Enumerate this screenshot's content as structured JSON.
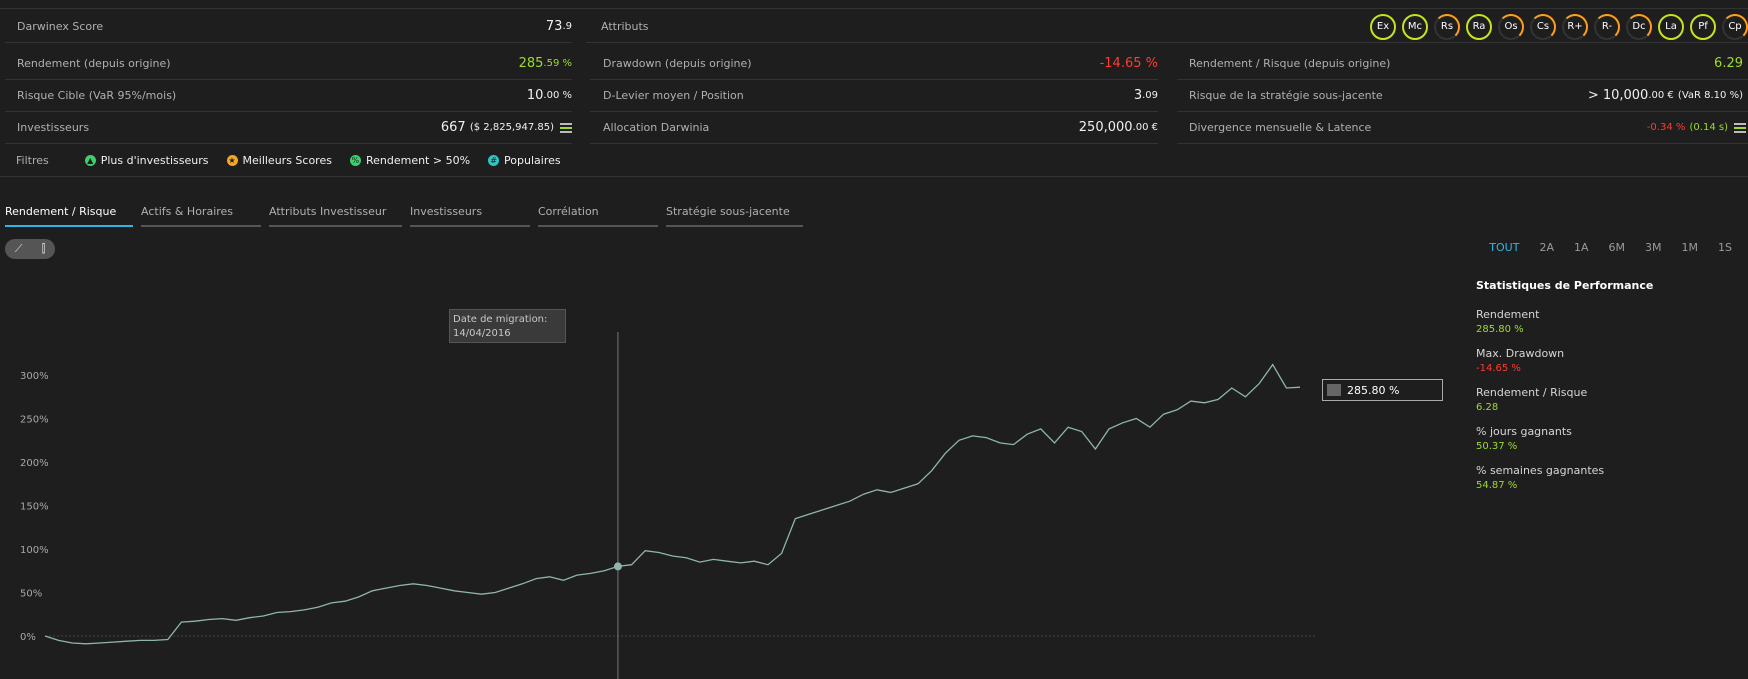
{
  "metrics": {
    "darwinex_score": {
      "label": "Darwinex Score",
      "value": "73",
      "decimals": ".9"
    },
    "attributs": {
      "label": "Attributs"
    },
    "rendement": {
      "label": "Rendement (depuis origine)",
      "value": "285",
      "decimals": ".59 %"
    },
    "drawdown": {
      "label": "Drawdown (depuis origine)",
      "value": "-14.65 %"
    },
    "rend_risque": {
      "label": "Rendement / Risque (depuis origine)",
      "value": "6.29"
    },
    "risque_cible": {
      "label": "Risque Cible (VaR 95%/mois)",
      "value": "10",
      "decimals": ".00 %"
    },
    "levier": {
      "label": "D-Levier moyen / Position",
      "value": "3",
      "decimals": ".09"
    },
    "risque_strat": {
      "label": "Risque de la stratégie sous-jacente",
      "value": "> 10,000",
      "decimals": ".00 €",
      "extra": "(VaR 8.10 %)"
    },
    "investisseurs": {
      "label": "Investisseurs",
      "value": "667",
      "extra": "($ 2,825,947.85)"
    },
    "allocation": {
      "label": "Allocation Darwinia",
      "value": "250,000",
      "decimals": ".00 €"
    },
    "divergence": {
      "label": "Divergence mensuelle & Latence",
      "value": "-0.34 %",
      "extra": "(0.14 s)"
    }
  },
  "attributes": [
    {
      "code": "Ex",
      "state": "full"
    },
    {
      "code": "Mc",
      "state": "full"
    },
    {
      "code": "Rs",
      "state": "part"
    },
    {
      "code": "Ra",
      "state": "full"
    },
    {
      "code": "Os",
      "state": "part"
    },
    {
      "code": "Cs",
      "state": "part"
    },
    {
      "code": "R+",
      "state": "part"
    },
    {
      "code": "R-",
      "state": "part"
    },
    {
      "code": "Dc",
      "state": "part"
    },
    {
      "code": "La",
      "state": "full"
    },
    {
      "code": "Pf",
      "state": "full"
    },
    {
      "code": "Cp",
      "state": "part"
    }
  ],
  "filters": {
    "label": "Filtres",
    "chips": [
      {
        "label": "Plus d'investisseurs",
        "color": "#3ecf6e"
      },
      {
        "label": "Meilleurs Scores",
        "color": "#f5a623"
      },
      {
        "label": "Rendement > 50%",
        "color": "#3ecf6e"
      },
      {
        "label": "Populaires",
        "color": "#2fc4c4"
      }
    ]
  },
  "tabs": [
    "Rendement / Risque",
    "Actifs & Horaires",
    "Attributs Investisseur",
    "Investisseurs",
    "Corrélation",
    "Stratégie sous-jacente"
  ],
  "range_buttons": [
    "TOUT",
    "2A",
    "1A",
    "6M",
    "3M",
    "1M",
    "1S"
  ],
  "range_active": "TOUT",
  "tooltip": {
    "title": "Date de migration:",
    "date": "14/04/2016"
  },
  "end_label": "285.80 %",
  "stats": {
    "title": "Statistiques de Performance",
    "items": [
      {
        "label": "Rendement",
        "value": "285.80 %",
        "tone": "green"
      },
      {
        "label": "Max. Drawdown",
        "value": "-14.65 %",
        "tone": "red"
      },
      {
        "label": "Rendement / Risque",
        "value": "6.28",
        "tone": "green"
      },
      {
        "label": "% jours gagnants",
        "value": "50.37 %",
        "tone": "green"
      },
      {
        "label": "% semaines gagnantes",
        "value": "54.87 %",
        "tone": "green"
      }
    ]
  },
  "chart_data": {
    "type": "line",
    "yticks": [
      "0%",
      "50%",
      "100%",
      "150%",
      "200%",
      "250%",
      "300%"
    ],
    "ylim": [
      -15,
      330
    ],
    "migration_index": 0.46,
    "series": [
      {
        "values": [
          0,
          -5,
          -8,
          -9,
          -8,
          -7,
          -6,
          -5,
          -5,
          -4,
          16,
          17,
          19,
          20,
          18,
          21,
          23,
          27,
          28,
          30,
          33,
          38,
          40,
          45,
          52,
          55,
          58,
          60,
          58,
          55,
          52,
          50,
          48,
          50,
          55,
          60,
          66,
          68,
          64,
          70,
          72,
          75,
          80,
          82,
          98,
          96,
          92,
          90,
          85,
          88,
          86,
          84,
          86,
          82,
          95,
          135,
          140,
          145,
          150,
          155,
          163,
          168,
          165,
          170,
          175,
          190,
          210,
          225,
          230,
          228,
          222,
          220,
          232,
          238,
          222,
          240,
          235,
          215,
          238,
          245,
          250,
          240,
          255,
          260,
          270,
          268,
          272,
          285,
          275,
          290,
          312,
          285,
          286
        ]
      }
    ]
  },
  "colors": {
    "line": "#8fb5ae",
    "accent": "#2fb6e6",
    "green": "#9bdc2c",
    "red": "#ff3b30"
  }
}
